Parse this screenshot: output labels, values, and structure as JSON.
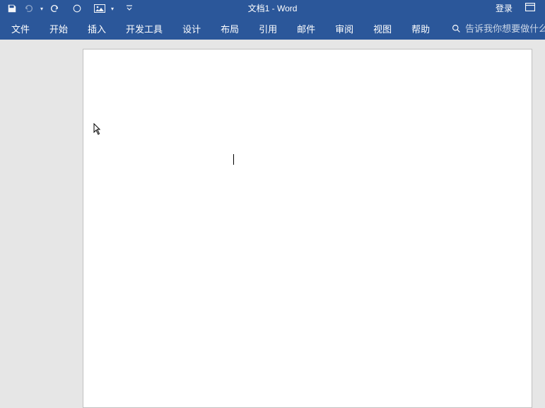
{
  "qat": {
    "save": "save-icon",
    "undo": "undo-icon",
    "redo": "redo-icon",
    "touch": "touch-mode-icon",
    "image": "image-placeholder-icon"
  },
  "title": {
    "document": "文档1",
    "separator": " - ",
    "app": "Word"
  },
  "account": {
    "login": "登录",
    "minimize_ribbon": "minimize-ribbon-icon"
  },
  "tabs": {
    "file": "文件",
    "home": "开始",
    "insert": "插入",
    "developer": "开发工具",
    "design": "设计",
    "layout": "布局",
    "references": "引用",
    "mailings": "邮件",
    "review": "审阅",
    "view": "视图",
    "help": "帮助"
  },
  "search": {
    "placeholder": "告诉我你想要做什么"
  }
}
